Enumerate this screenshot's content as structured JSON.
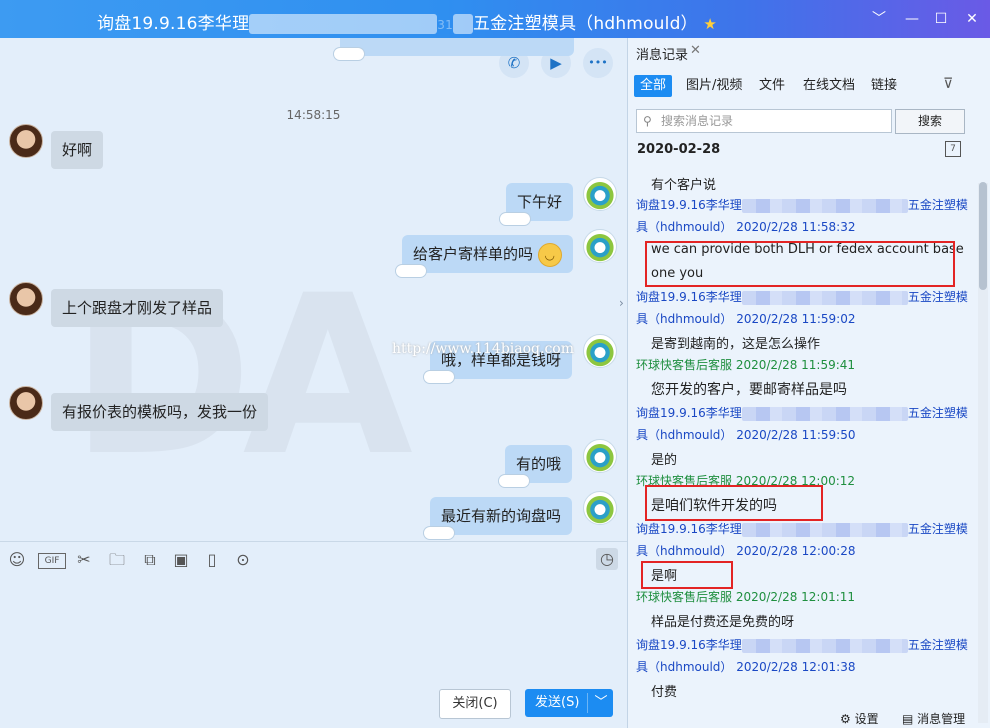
{
  "window": {
    "title_prefix": "询盘19.9.16李华理",
    "title_mid": "31",
    "title_suffix": "五金注塑模具（hdhmould）",
    "star": "★",
    "controls": [
      "﹀",
      "—",
      "☐",
      "✕"
    ]
  },
  "chat": {
    "call_icons": [
      "✆",
      "▶",
      "•••"
    ],
    "time": "14:58:15",
    "watermark_url": "http://www.114biaoq.com",
    "messages": [
      {
        "side": "left",
        "text": "好啊"
      },
      {
        "side": "right",
        "text": "下午好"
      },
      {
        "side": "right",
        "text": "给客户寄样单的吗",
        "emoji": "😌"
      },
      {
        "side": "left",
        "text": "上个跟盘才刚发了样品"
      },
      {
        "side": "right",
        "text": "哦，样单都是钱呀"
      },
      {
        "side": "left",
        "text": "有报价表的模板吗，发我一份"
      },
      {
        "side": "right",
        "text": "有的哦"
      },
      {
        "side": "right",
        "text": "最近有新的询盘吗"
      }
    ]
  },
  "toolbar": {
    "icons": [
      "emoji-icon",
      "gif-icon",
      "scissors-icon",
      "folder-icon",
      "screenshot-icon",
      "image-icon",
      "vibrate-icon",
      "more-icon",
      "history-icon"
    ]
  },
  "input": {
    "close_label": "关闭(C)",
    "send_label": "发送(S)",
    "send_dropdown": "﹀"
  },
  "side": {
    "tab_label": "消息记录",
    "tab_close": "✕",
    "filters": [
      "全部",
      "图片/视频",
      "文件",
      "在线文档",
      "链接"
    ],
    "search_placeholder": "搜索消息记录",
    "search_button": "搜索",
    "date": "2020-02-28",
    "entries": [
      {
        "type": "msg",
        "text": "有个客户说"
      },
      {
        "type": "sender-blue",
        "prefix": "询盘19.9.16李华理",
        "suffix": "五金注塑模"
      },
      {
        "type": "sender-blue",
        "text": "具（hdhmould）  2020/2/28 11:58:32"
      },
      {
        "type": "msg",
        "text": "we can provide both DLH or fedex account base"
      },
      {
        "type": "msg",
        "text": "one you"
      },
      {
        "type": "sender-blue",
        "prefix": "询盘19.9.16李华理",
        "suffix": "五金注塑模"
      },
      {
        "type": "sender-blue",
        "text": "具（hdhmould）  2020/2/28 11:59:02"
      },
      {
        "type": "msg",
        "text": "是寄到越南的，这是怎么操作"
      },
      {
        "type": "sender-green",
        "text": "环球快客售后客服  2020/2/28 11:59:41"
      },
      {
        "type": "msg",
        "text": "您开发的客户，要邮寄样品是吗"
      },
      {
        "type": "sender-blue",
        "prefix": "询盘19.9.16李华理",
        "suffix": "五金注塑模"
      },
      {
        "type": "sender-blue",
        "text": "具（hdhmould）  2020/2/28 11:59:50"
      },
      {
        "type": "msg",
        "text": "是的"
      },
      {
        "type": "sender-green",
        "text": "环球快客售后客服  2020/2/28 12:00:12"
      },
      {
        "type": "msg",
        "text": "是咱们软件开发的吗"
      },
      {
        "type": "sender-blue",
        "prefix": "询盘19.9.16李华理",
        "suffix": "五金注塑模"
      },
      {
        "type": "sender-blue",
        "text": "具（hdhmould）  2020/2/28 12:00:28"
      },
      {
        "type": "msg",
        "text": "是啊"
      },
      {
        "type": "sender-green",
        "text": "环球快客售后客服  2020/2/28 12:01:11"
      },
      {
        "type": "msg",
        "text": "样品是付费还是免费的呀"
      },
      {
        "type": "sender-blue",
        "prefix": "询盘19.9.16李华理",
        "suffix": "五金注塑模"
      },
      {
        "type": "sender-blue",
        "text": "具（hdhmould）  2020/2/28 12:01:38"
      },
      {
        "type": "msg",
        "text": "付费"
      }
    ],
    "footer_settings": "设置",
    "footer_manage": "消息管理"
  }
}
